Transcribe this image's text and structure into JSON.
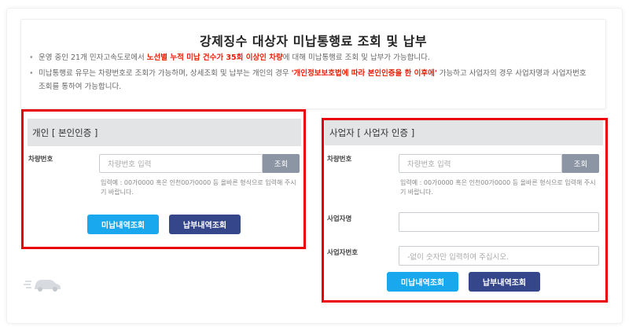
{
  "title": "강제징수 대상자 미납통행료 조회 및 납부",
  "notices": [
    {
      "pre": "운영 중인 21개 민자고속도로에서 ",
      "highlight": "노선별 누적 미납 건수가 35회 이상인 차량",
      "post": "에 대해 미납통행료 조회 및 납부가 가능합니다."
    },
    {
      "pre": "미납통행료 유무는 차량번호로 조회가 가능하며, 상세조회 및 납부는 개인의 경우 ",
      "highlight": "'개인정보보호법에 따라 본인인증을 한 이후에'",
      "post": " 가능하고 사업자의 경우 사업자명과 사업자번호 조회를 통하여 가능합니다."
    }
  ],
  "personal": {
    "header": "개인 [ 본인인증 ]",
    "vehicle_label": "차량번호",
    "vehicle_placeholder": "차량번호 입력",
    "search_label": "조회",
    "hint": "입력예 : 00가0000 혹은 인천00가0000 등 올바른 형식으로 입력해 주시기 바랍니다.",
    "unpaid_button": "미납내역조회",
    "paid_button": "납부내역조회"
  },
  "business": {
    "header": "사업자 [ 사업자 인증 ]",
    "vehicle_label": "차량번호",
    "vehicle_placeholder": "차량번호 입력",
    "search_label": "조회",
    "hint": "입력예 : 00가0000 혹은 인천00가0000 등 올바른 형식으로 입력해 주시기 바랍니다.",
    "name_label": "사업자명",
    "name_value": "",
    "number_label": "사업자번호",
    "number_placeholder": "-없이 숫자만 입력하여 주십시오.",
    "unpaid_button": "미납내역조회",
    "paid_button": "납부내역조회"
  },
  "colors": {
    "highlight": "#e8200a",
    "frame": "#e8000b",
    "sky_button": "#19a8ee",
    "navy_button": "#35478a",
    "search_button": "#8b95a3"
  },
  "icons": {
    "car": "car-icon"
  }
}
